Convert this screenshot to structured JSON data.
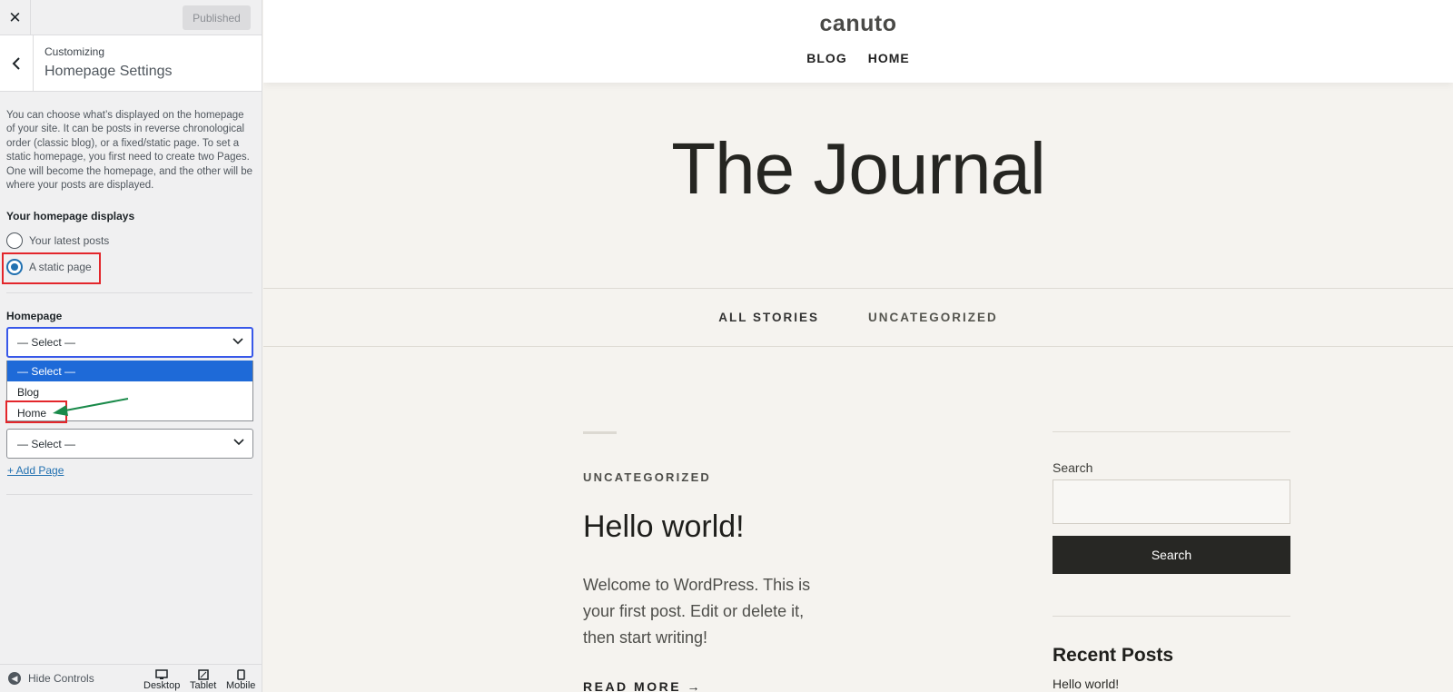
{
  "sidebar": {
    "close_label": "✕",
    "publish_label": "Published",
    "header": {
      "subtitle": "Customizing",
      "title": "Homepage Settings"
    },
    "description": "You can choose what’s displayed on the homepage of your site. It can be posts in reverse chronological order (classic blog), or a fixed/static page. To set a static homepage, you first need to create two Pages. One will become the homepage, and the other will be where your posts are displayed.",
    "displays_label": "Your homepage displays",
    "radio_options": [
      "Your latest posts",
      "A static page"
    ],
    "radio_selected": "A static page",
    "homepage_label": "Homepage",
    "homepage_select_value": "— Select —",
    "dropdown_options": [
      "— Select —",
      "Blog",
      "Home"
    ],
    "posts_select_value": "— Select —",
    "add_page_label": "+ Add Page",
    "footer": {
      "hide_controls": "Hide Controls",
      "devices": [
        "Desktop",
        "Tablet",
        "Mobile"
      ]
    }
  },
  "site": {
    "title": "canuto",
    "nav": [
      "BLOG",
      "HOME"
    ],
    "hero_title": "The Journal",
    "categories": [
      "ALL STORIES",
      "UNCATEGORIZED"
    ],
    "post": {
      "category": "UNCATEGORIZED",
      "title": "Hello world!",
      "excerpt": "Welcome to WordPress. This is your first post. Edit or delete it, then start writing!",
      "read_more": "READ MORE →"
    },
    "widgets": {
      "search_label": "Search",
      "search_button": "Search",
      "recent_posts_title": "Recent Posts",
      "recent_posts": [
        "Hello world!"
      ]
    }
  },
  "colors": {
    "highlight_box": "#e3262b",
    "annotation_arrow": "#1a8a4a",
    "focus_blue": "#3858e9",
    "option_selected_bg": "#1e6ad8"
  }
}
